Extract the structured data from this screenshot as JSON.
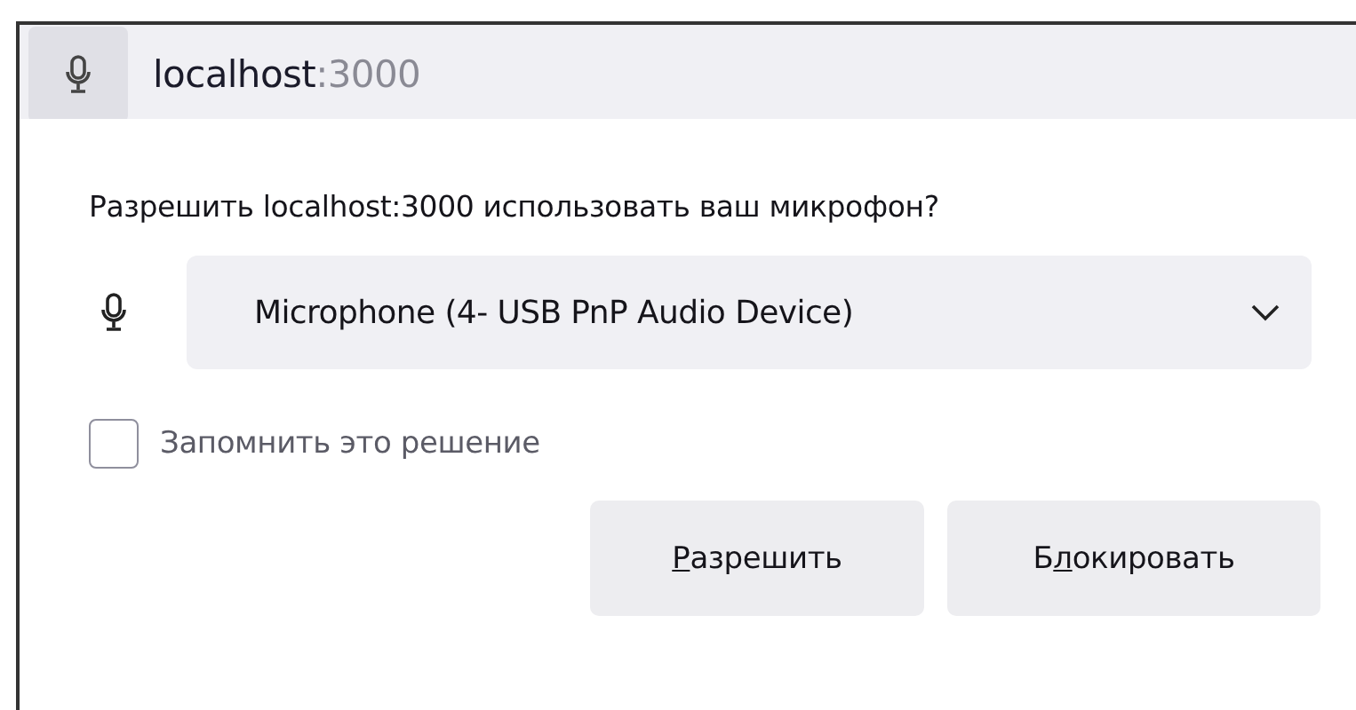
{
  "address_bar": {
    "host": "localhost",
    "port": ":3000"
  },
  "prompt": {
    "question": "Разрешить localhost:3000 использовать ваш микрофон?",
    "device_select": {
      "value": "Microphone (4- USB PnP Audio Device)"
    },
    "remember": {
      "label": "Запомнить это решение",
      "checked": false
    },
    "buttons": [
      {
        "access_key": "Р",
        "label_end": "азрешить"
      },
      {
        "label_start": "Б",
        "access_key": "л",
        "label_end": "окировать"
      }
    ]
  }
}
